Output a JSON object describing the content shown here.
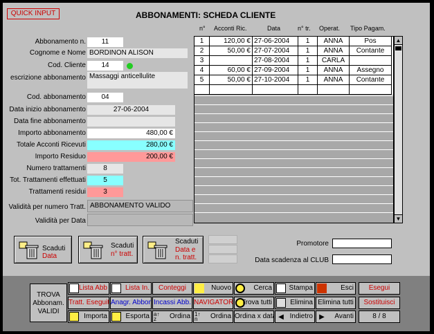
{
  "header": {
    "quick_input": "QUICK INPUT",
    "title": "ABBONAMENTI: SCHEDA CLIENTE"
  },
  "table": {
    "headers": [
      "n°",
      "Acconti Ric.",
      "Data",
      "n° tr.",
      "Operat.",
      "Tipo Pagam."
    ],
    "rows": [
      {
        "n": "1",
        "acconto": "120,00 €",
        "data": "27-06-2004",
        "ntr": "1",
        "operat": "ANNA",
        "tipo": "Pos"
      },
      {
        "n": "2",
        "acconto": "50,00 €",
        "data": "27-07-2004",
        "ntr": "1",
        "operat": "ANNA",
        "tipo": "Contante"
      },
      {
        "n": "3",
        "acconto": "",
        "data": "27-08-2004",
        "ntr": "1",
        "operat": "CARLA",
        "tipo": ""
      },
      {
        "n": "4",
        "acconto": "60,00 €",
        "data": "27-09-2004",
        "ntr": "1",
        "operat": "ANNA",
        "tipo": "Assegno"
      },
      {
        "n": "5",
        "acconto": "50,00 €",
        "data": "27-10-2004",
        "ntr": "1",
        "operat": "ANNA",
        "tipo": "Contante"
      }
    ]
  },
  "form": {
    "abbonamento_n_label": "Abbonamento n.",
    "abbonamento_n": "11",
    "cognome_nome_label": "Cognome e Nome",
    "cognome_nome": "BORDINON ALISON",
    "cod_cliente_label": "Cod. Cliente",
    "cod_cliente": "14",
    "descrizione_label": "escrizione abbonamento",
    "descrizione": "Massaggi anticellulite",
    "cod_abbonamento_label": "Cod. abbonamento",
    "cod_abbonamento": "04",
    "data_inizio_label": "Data inizio abbonamento",
    "data_inizio": "27-06-2004",
    "data_fine_label": "Data fine abbonamento",
    "data_fine": "",
    "importo_label": "Importo abbonamento",
    "importo": "480,00 €",
    "totale_acconti_label": "Totale Acconti Ricevuti",
    "totale_acconti": "280,00 €",
    "importo_residuo_label": "Importo Residuo",
    "importo_residuo": "200,00 €",
    "numero_trattamenti_label": "Numero trattamenti",
    "numero_trattamenti": "8",
    "tot_effettuati_label": "Tot. Trattamenti effettuati",
    "tot_effettuati": "5",
    "residui_label": "Trattamenti residui",
    "residui": "3",
    "validita_tratt_label": "Validità per numero Tratt.",
    "validita_tratt": "ABBONAMENTO VALIDO",
    "validita_data_label": "Validità per Data",
    "validita_data": "",
    "promotore_label": "Promotore",
    "promotore": "",
    "scadenza_club_label": "Data scadenza al CLUB",
    "scadenza_club": "",
    "status_color": "#22cc22"
  },
  "bigbuttons": [
    {
      "l1": "Scaduti",
      "l2": "Data"
    },
    {
      "l1": "Scaduti",
      "l2": "n° tratt."
    },
    {
      "l1": "Scaduti",
      "l2": "Data  e",
      "l3": "n. tratt."
    }
  ],
  "footer": {
    "trova": [
      "TROVA",
      "Abbonam.",
      "VALIDI"
    ],
    "lista_abb": "Lista Abb",
    "lista_in": "Lista In.",
    "conteggi": "Conteggi",
    "nuovo": "Nuovo",
    "cerca": "Cerca",
    "stampa": "Stampa",
    "esci": "Esci",
    "esegui": "Esegui",
    "tratt_eseguiti": "Tratt. Eseguiti",
    "anagr_abbon": "Anagr. Abbon",
    "incassi_abb": "Incassi Abb.",
    "navigator": "NAVIGATOR",
    "trova_tutti": "Trova tutti",
    "elimina": "Elimina",
    "elimina_tutti": "Elimina tutti",
    "sostituisci": "Sostituisci",
    "importa": "Importa",
    "esporta": "Esporta",
    "ordina1": "Ordina",
    "ordina2": "Ordina",
    "ordina_data": "Ordina x data",
    "indietro": "Indietro",
    "avanti": "Avanti",
    "record": "8 / 8"
  }
}
